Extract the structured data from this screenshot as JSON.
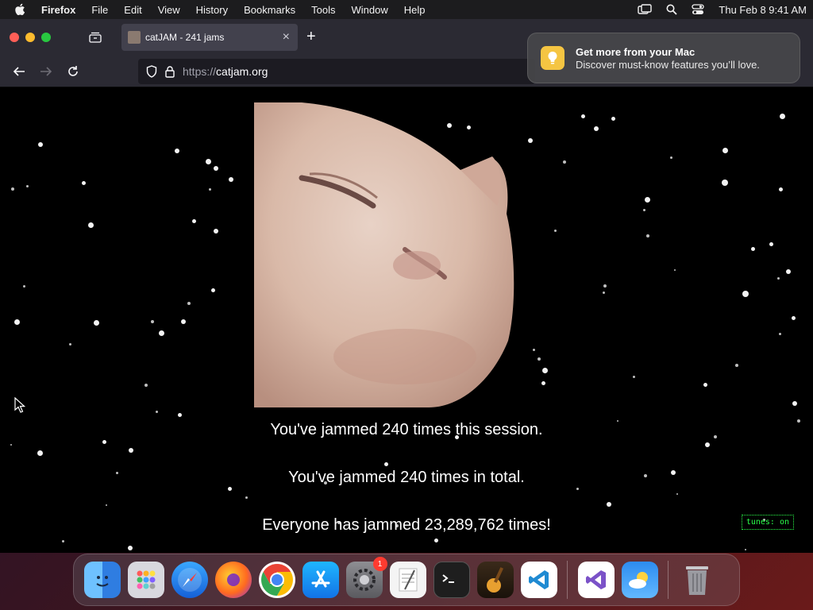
{
  "menubar": {
    "app_name": "Firefox",
    "items": [
      "File",
      "Edit",
      "View",
      "History",
      "Bookmarks",
      "Tools",
      "Window",
      "Help"
    ],
    "datetime": "Thu Feb 8  9:41 AM"
  },
  "browser": {
    "tab_title": "catJAM - 241 jams",
    "url_scheme": "https://",
    "url_host": "catjam.org"
  },
  "notification": {
    "title": "Get more from your Mac",
    "subtitle": "Discover must-know features you’ll love."
  },
  "page": {
    "session_text": "You've jammed 240 times this session.",
    "total_text": "You've jammed 240 times in total.",
    "everyone_text": "Everyone has jammed 23,289,762 times!",
    "tunes_label": "tunes: on"
  },
  "dock": {
    "apps": [
      {
        "name": "finder",
        "label": "Finder"
      },
      {
        "name": "launchpad",
        "label": "Launchpad"
      },
      {
        "name": "safari",
        "label": "Safari"
      },
      {
        "name": "firefox",
        "label": "Firefox"
      },
      {
        "name": "chrome",
        "label": "Chrome"
      },
      {
        "name": "app-store",
        "label": "App Store"
      },
      {
        "name": "system-settings",
        "label": "System Settings",
        "badge": "1"
      },
      {
        "name": "textedit",
        "label": "TextEdit"
      },
      {
        "name": "terminal",
        "label": "Terminal"
      },
      {
        "name": "garageband",
        "label": "GarageBand"
      },
      {
        "name": "vscode",
        "label": "Visual Studio Code"
      },
      {
        "name": "visual-studio",
        "label": "Visual Studio"
      },
      {
        "name": "weather",
        "label": "Weather"
      },
      {
        "name": "trash",
        "label": "Trash"
      }
    ]
  },
  "colors": {
    "tunes_green": "#2aff4a",
    "page_bg": "#000000",
    "tab_bg": "#42414d",
    "toolbar_bg": "#2b2a33"
  }
}
